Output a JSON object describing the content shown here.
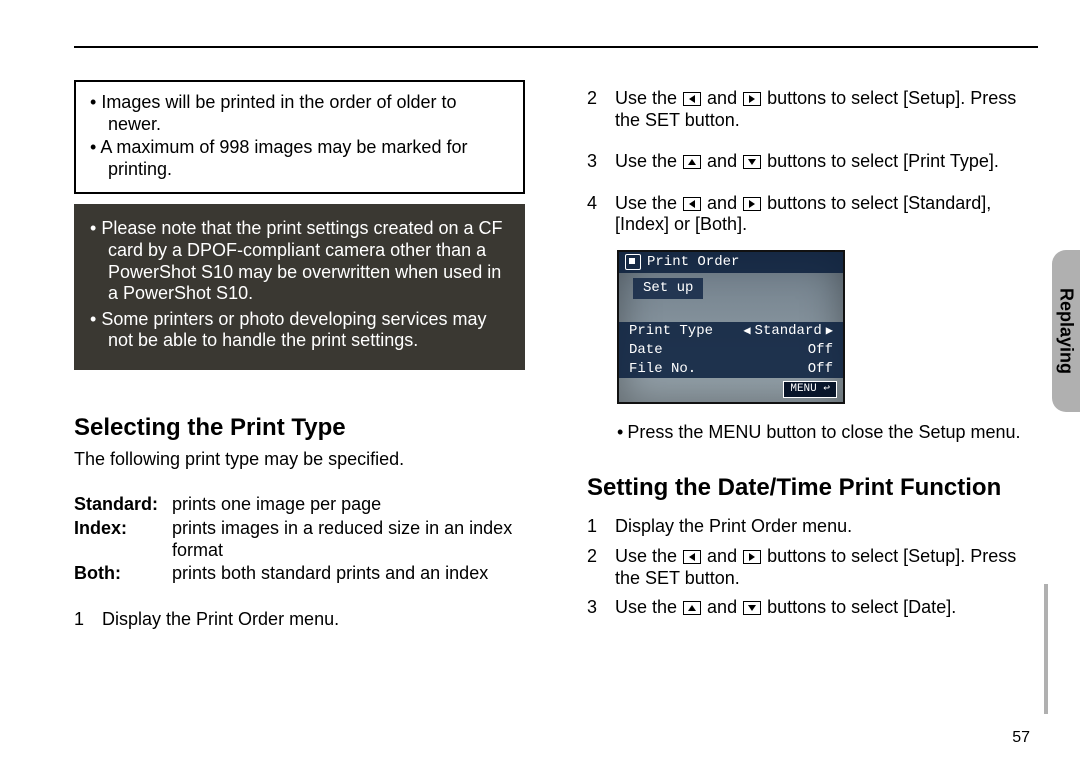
{
  "page_number": "57",
  "side_tab": "Replaying",
  "left": {
    "info_box": [
      "Images will be printed in the order of older to newer.",
      "A maximum of 998 images may be marked for printing."
    ],
    "warning_box": [
      "Please note that the print settings created on a CF card by a DPOF-compliant camera other than a PowerShot S10 may be overwritten when used in a PowerShot S10.",
      "Some printers or photo developing services may not be able to handle the print settings."
    ],
    "section_title": "Selecting the Print Type",
    "lead": "The following print type may be specified.",
    "defs": [
      {
        "term": "Standard:",
        "desc": "prints one image per page"
      },
      {
        "term": "Index:",
        "desc": "prints images in a reduced size in an index format"
      },
      {
        "term": "Both:",
        "desc": "prints both standard prints and an index"
      }
    ],
    "steps": [
      {
        "num": "1",
        "body": "Display the Print Order menu."
      }
    ]
  },
  "right": {
    "steps_a": [
      {
        "num": "2",
        "pre": "Use the ",
        "mid": " and ",
        "post": " buttons to select [Setup]. Press the SET button.",
        "dir1": "left",
        "dir2": "right"
      },
      {
        "num": "3",
        "pre": "Use the ",
        "mid": " and ",
        "post": " buttons to select [Print Type].",
        "dir1": "up",
        "dir2": "down"
      },
      {
        "num": "4",
        "pre": "Use the ",
        "mid": " and ",
        "post": " buttons to select [Standard], [Index] or [Both].",
        "dir1": "left",
        "dir2": "right"
      }
    ],
    "lcd": {
      "title": "Print Order",
      "setup": "Set up",
      "rows": [
        {
          "k": "Print Type",
          "v": "Standard",
          "sel": true
        },
        {
          "k": "Date",
          "v": "Off",
          "sel": false
        },
        {
          "k": "File No.",
          "v": "Off",
          "sel": false
        }
      ],
      "menu": "MENU ↩"
    },
    "after_lcd": "Press the MENU button to close the Setup menu.",
    "section_title": "Setting the Date/Time Print Function",
    "steps_b": [
      {
        "num": "1",
        "body": "Display the Print Order menu."
      },
      {
        "num": "2",
        "pre": "Use the ",
        "mid": " and ",
        "post": " buttons to select [Setup]. Press the SET button.",
        "dir1": "left",
        "dir2": "right"
      },
      {
        "num": "3",
        "pre": "Use the ",
        "mid": " and ",
        "post": " buttons to select [Date].",
        "dir1": "up",
        "dir2": "down"
      }
    ]
  }
}
